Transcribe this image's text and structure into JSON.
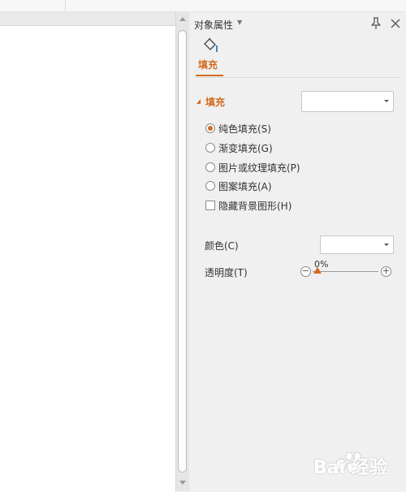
{
  "pane": {
    "title": "对象属性",
    "tab_fill": "填充",
    "section_title": "填充",
    "fill_options": [
      {
        "label": "纯色填充(S)",
        "selected": true
      },
      {
        "label": "渐变填充(G)",
        "selected": false
      },
      {
        "label": "图片或纹理填充(P)",
        "selected": false
      },
      {
        "label": "图案填充(A)",
        "selected": false
      }
    ],
    "hide_background": {
      "label": "隐藏背景图形(H)",
      "checked": false
    },
    "color_label": "颜色(C)",
    "transparency_label": "透明度(T)",
    "transparency_value": "0%",
    "transparency_level": 0
  },
  "icons": {
    "title_caret": "chevron-down-icon",
    "pin": "pin-icon",
    "close": "close-icon",
    "fill": "paint-bucket-icon"
  },
  "colors": {
    "accent": "#d36b1f",
    "pane_bg": "#f0f0f0",
    "canvas_bg": "#ffffff"
  },
  "watermark": {
    "text": "Bai 经验"
  }
}
